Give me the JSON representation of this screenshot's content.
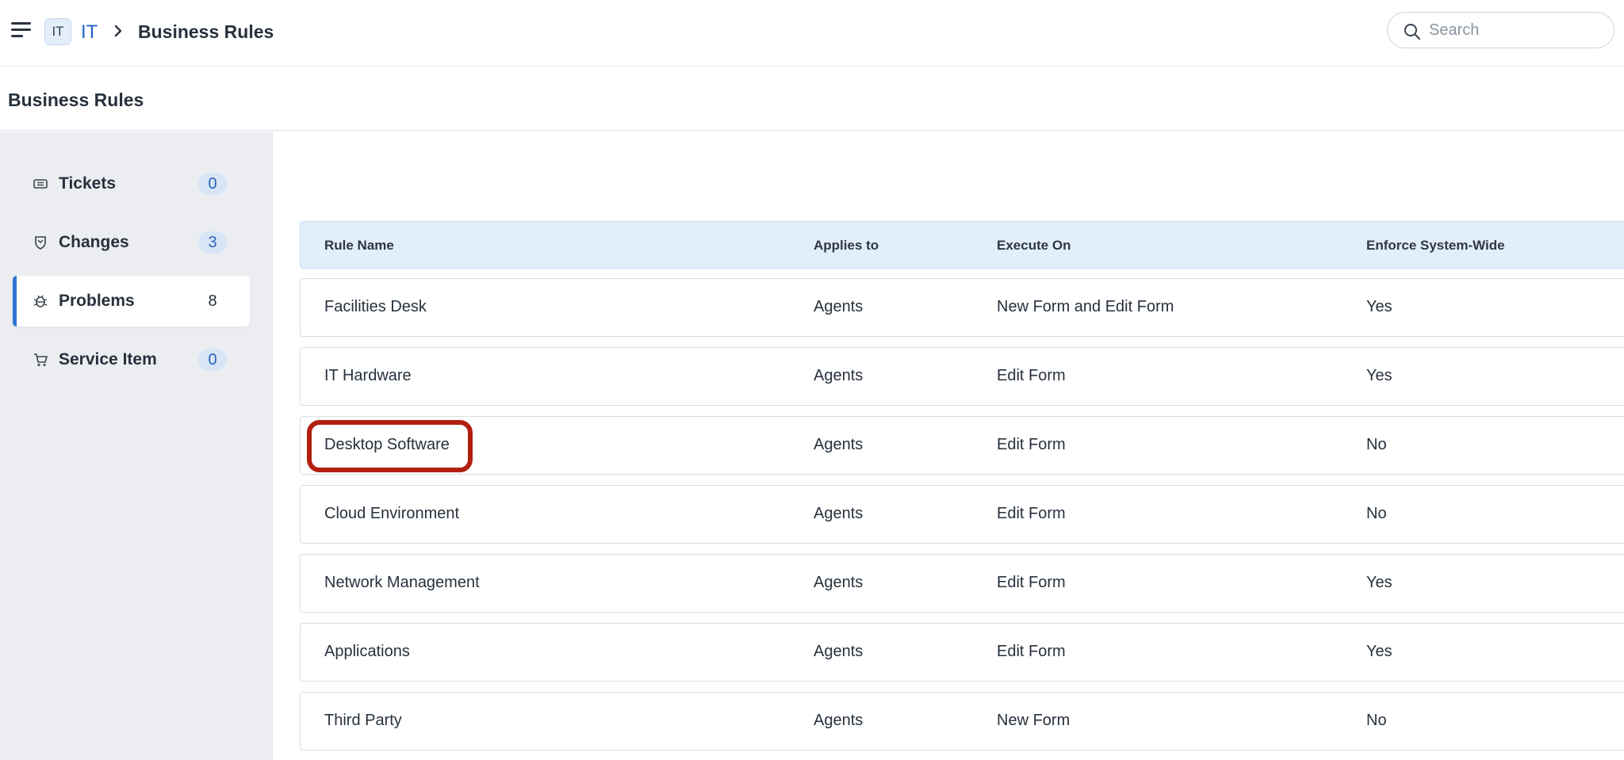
{
  "header": {
    "menu_icon": "hamburger-menu-icon",
    "workspace_badge": "IT",
    "workspace_link": "IT",
    "breadcrumb_separator_icon": "chevron-right-icon",
    "breadcrumb_current": "Business Rules",
    "search": {
      "placeholder": "Search",
      "value": "",
      "icon": "search-icon"
    }
  },
  "page": {
    "title": "Business Rules"
  },
  "sidebar": {
    "items": [
      {
        "label": "Tickets",
        "count": "0",
        "icon": "ticket-icon",
        "active": false
      },
      {
        "label": "Changes",
        "count": "3",
        "icon": "changes-shield-icon",
        "active": false
      },
      {
        "label": "Problems",
        "count": "8",
        "icon": "bug-icon",
        "active": true
      },
      {
        "label": "Service Item",
        "count": "0",
        "icon": "cart-icon",
        "active": false
      }
    ]
  },
  "table": {
    "columns": [
      "Rule Name",
      "Applies to",
      "Execute On",
      "Enforce System-Wide"
    ],
    "rows": [
      {
        "name": "Facilities Desk",
        "applies_to": "Agents",
        "execute_on": "New Form and Edit Form",
        "enforce": "Yes"
      },
      {
        "name": "IT Hardware",
        "applies_to": "Agents",
        "execute_on": "Edit Form",
        "enforce": "Yes"
      },
      {
        "name": "Desktop Software",
        "applies_to": "Agents",
        "execute_on": "Edit Form",
        "enforce": "No",
        "highlighted": true
      },
      {
        "name": "Cloud Environment",
        "applies_to": "Agents",
        "execute_on": "Edit Form",
        "enforce": "No"
      },
      {
        "name": "Network Management",
        "applies_to": "Agents",
        "execute_on": "Edit Form",
        "enforce": "Yes"
      },
      {
        "name": "Applications",
        "applies_to": "Agents",
        "execute_on": "Edit Form",
        "enforce": "Yes"
      },
      {
        "name": "Third Party",
        "applies_to": "Agents",
        "execute_on": "New Form",
        "enforce": "No"
      }
    ]
  },
  "colors": {
    "accent": "#2e74d6",
    "highlight_ring": "#b21f0e",
    "table_header_bg": "#e3eefc",
    "sidebar_bg": "#ebedf1"
  }
}
